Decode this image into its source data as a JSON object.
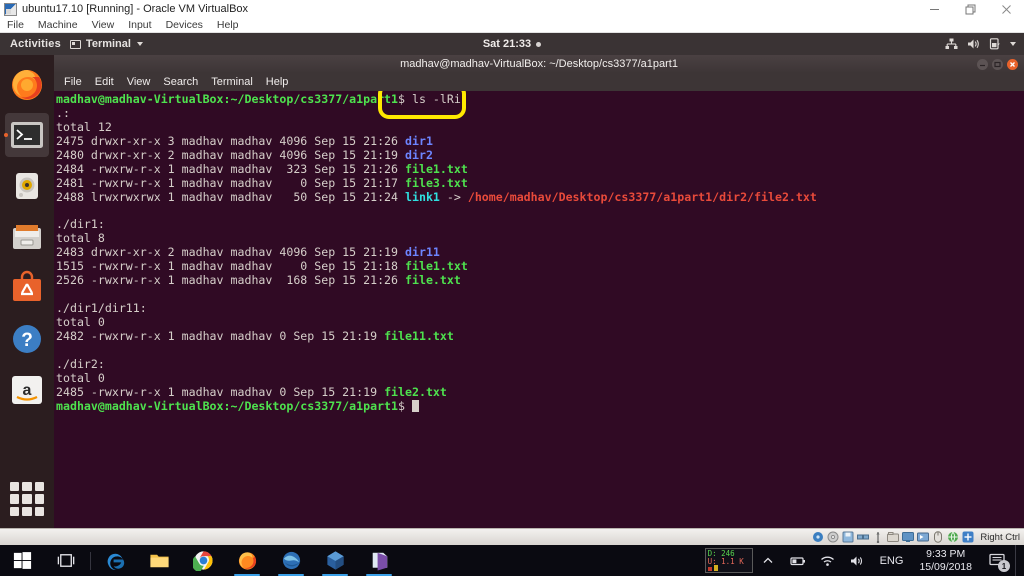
{
  "vbox": {
    "title": "ubuntu17.10 [Running] - Oracle VM VirtualBox",
    "app_icon": "virtualbox-icon",
    "menus": [
      "File",
      "Machine",
      "View",
      "Input",
      "Devices",
      "Help"
    ],
    "window_controls": [
      "minimize-button",
      "restore-button",
      "close-button"
    ],
    "status": {
      "host_key": "Right Ctrl",
      "indicators": [
        "hard-disk-icon",
        "optical-disk-icon",
        "floppy-icon",
        "network-icon",
        "usb-icon",
        "shared-folder-icon",
        "display-icon",
        "video-capture-icon",
        "mouse-icon",
        "remote-desktop-icon",
        "host-key-icon"
      ]
    }
  },
  "ubuntu_panel": {
    "activities": "Activities",
    "app_name": "Terminal",
    "app_icon": "terminal-icon",
    "clock": "Sat 21:33",
    "clock_dot": "notification-dot",
    "tray": [
      "network-icon",
      "volume-icon",
      "battery-icon",
      "chevron-down-icon"
    ]
  },
  "dock": {
    "items": [
      {
        "name": "firefox",
        "label": "Firefox",
        "active": false
      },
      {
        "name": "terminal",
        "label": "Terminal",
        "active": true
      },
      {
        "name": "rhythmbox",
        "label": "Rhythmbox",
        "active": false
      },
      {
        "name": "files",
        "label": "Files",
        "active": false
      },
      {
        "name": "software",
        "label": "Ubuntu Software",
        "active": false
      },
      {
        "name": "help",
        "label": "Help",
        "active": false
      },
      {
        "name": "amazon",
        "label": "Amazon",
        "active": false
      }
    ],
    "show_applications": "Show Applications"
  },
  "terminal": {
    "title": "madhav@madhav-VirtualBox: ~/Desktop/cs3377/a1part1",
    "menus": [
      "File",
      "Edit",
      "View",
      "Search",
      "Terminal",
      "Help"
    ],
    "window_buttons": [
      "minimize-button",
      "maximize-button",
      "close-button"
    ],
    "colors": {
      "background": "#300a24",
      "prompt_green": "#4ee24e",
      "directory_blue": "#6d85ff",
      "executable_green": "#4ee24e",
      "symlink_cyan": "#2fe0e0",
      "symlink_target_red": "#e84a3a",
      "foreground": "#d6cfca"
    },
    "prompt": "madhav@madhav-VirtualBox:~/Desktop/cs3377/a1part1$",
    "command": "ls -lRi",
    "lines": [
      {
        "type": "prompt",
        "prompt": "madhav@madhav-VirtualBox:~/Desktop/cs3377/a1part1",
        "command": "$ ls -lRi"
      },
      {
        "type": "plain",
        "text": ".:"
      },
      {
        "type": "plain",
        "text": "total 12"
      },
      {
        "type": "entry",
        "meta": "2475 drwxr-xr-x 3 madhav madhav 4096 Sep 15 21:26 ",
        "name": "dir1",
        "kind": "dir"
      },
      {
        "type": "entry",
        "meta": "2480 drwxr-xr-x 2 madhav madhav 4096 Sep 15 21:19 ",
        "name": "dir2",
        "kind": "dir"
      },
      {
        "type": "entry",
        "meta": "2484 -rwxrw-r-x 1 madhav madhav  323 Sep 15 21:26 ",
        "name": "file1.txt",
        "kind": "exe"
      },
      {
        "type": "entry",
        "meta": "2481 -rwxrw-r-x 1 madhav madhav    0 Sep 15 21:17 ",
        "name": "file3.txt",
        "kind": "exe"
      },
      {
        "type": "link",
        "meta": "2488 lrwxrwxrwx 1 madhav madhav   50 Sep 15 21:24 ",
        "name": "link1",
        "arrow": " -> ",
        "target": "/home/madhav/Desktop/cs3377/a1part1/dir2/file2.txt"
      },
      {
        "type": "blank",
        "text": ""
      },
      {
        "type": "plain",
        "text": "./dir1:"
      },
      {
        "type": "plain",
        "text": "total 8"
      },
      {
        "type": "entry",
        "meta": "2483 drwxr-xr-x 2 madhav madhav 4096 Sep 15 21:19 ",
        "name": "dir11",
        "kind": "dir"
      },
      {
        "type": "entry",
        "meta": "1515 -rwxrw-r-x 1 madhav madhav    0 Sep 15 21:18 ",
        "name": "file1.txt",
        "kind": "exe"
      },
      {
        "type": "entry",
        "meta": "2526 -rwxrw-r-x 1 madhav madhav  168 Sep 15 21:26 ",
        "name": "file.txt",
        "kind": "exe"
      },
      {
        "type": "blank",
        "text": ""
      },
      {
        "type": "plain",
        "text": "./dir1/dir11:"
      },
      {
        "type": "plain",
        "text": "total 0"
      },
      {
        "type": "entry",
        "meta": "2482 -rwxrw-r-x 1 madhav madhav 0 Sep 15 21:19 ",
        "name": "file11.txt",
        "kind": "exe"
      },
      {
        "type": "blank",
        "text": ""
      },
      {
        "type": "plain",
        "text": "./dir2:"
      },
      {
        "type": "plain",
        "text": "total 0"
      },
      {
        "type": "entry",
        "meta": "2485 -rwxrw-r-x 1 madhav madhav 0 Sep 15 21:19 ",
        "name": "file2.txt",
        "kind": "exe"
      },
      {
        "type": "cursor",
        "prompt": "madhav@madhav-VirtualBox:~/Desktop/cs3377/a1part1",
        "command": "$ "
      }
    ]
  },
  "annotation": {
    "color": "#ffe800",
    "label": "highlight-command-ls-lRi"
  },
  "windows_taskbar": {
    "buttons": [
      {
        "name": "start",
        "label": "Start"
      },
      {
        "name": "task-view",
        "label": "Task View"
      },
      {
        "name": "edge",
        "label": "Microsoft Edge",
        "running": false
      },
      {
        "name": "file-explorer",
        "label": "File Explorer",
        "running": false
      },
      {
        "name": "chrome",
        "label": "Google Chrome",
        "running": false
      },
      {
        "name": "firefox",
        "label": "Mozilla Firefox",
        "running": true
      },
      {
        "name": "thunderbird",
        "label": "Mozilla Thunderbird",
        "running": true
      },
      {
        "name": "virtualbox",
        "label": "Oracle VM VirtualBox",
        "running": true
      },
      {
        "name": "onenote",
        "label": "OneNote",
        "running": true
      }
    ],
    "network_monitor": {
      "download": "D: 246",
      "upload": "U: 1.1 K"
    },
    "tray": [
      "chevron-up-icon",
      "battery-icon",
      "wifi-icon",
      "volume-icon"
    ],
    "language": "ENG",
    "clock_time": "9:33 PM",
    "clock_date": "15/09/2018",
    "notification_count": "1"
  }
}
